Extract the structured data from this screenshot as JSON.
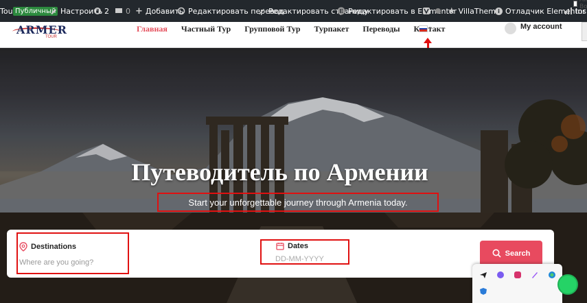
{
  "adminbar": {
    "site_fragment": "Tour",
    "public_badge": "Публичный",
    "customize": "Настроить",
    "updates_count": "2",
    "comments_count": "0",
    "add_new": "Добавить",
    "edit_translation": "Редактировать перевод",
    "edit_page": "Редактировать страницу",
    "edit_elementor": "Редактировать в Elementor",
    "villatheme": "VillaTheme",
    "elementor_debugger": "Отладчик Elementor",
    "insights_fragment": "Insig",
    "corner_checkbox_label": "All Bo"
  },
  "header": {
    "logo_text": "ARMER",
    "logo_subtext": "TOUR",
    "nav": [
      "Главная",
      "Частный Тур",
      "Групповой Тур",
      "Турпакет",
      "Переводы",
      "Контакт"
    ],
    "account_label": "My account"
  },
  "hero": {
    "title": "Путеводитель по Армении",
    "subtitle": "Start your unforgettable journey through Armenia today."
  },
  "search": {
    "destinations_label": "Destinations",
    "destinations_placeholder": "Where are you going?",
    "dates_label": "Dates",
    "dates_placeholder": "DD-MM-YYYY",
    "button_label": "Search"
  },
  "colors": {
    "adminbar_bg": "#23282d",
    "accent": "#e84a5f",
    "annotation_red": "#e01010",
    "badge_green": "#2c8a3e"
  },
  "icons": {
    "customize": "paintbrush-icon",
    "updates": "refresh-icon",
    "comments": "comment-icon",
    "add": "plus-icon",
    "edit_translation": "translate-icon",
    "edit_page": "pencil-icon",
    "elementor": "elementor-icon",
    "villatheme": "star-icon",
    "debugger": "info-icon",
    "location": "map-pin-icon",
    "calendar": "calendar-icon",
    "search": "search-icon",
    "whatsapp": "whatsapp-icon"
  }
}
